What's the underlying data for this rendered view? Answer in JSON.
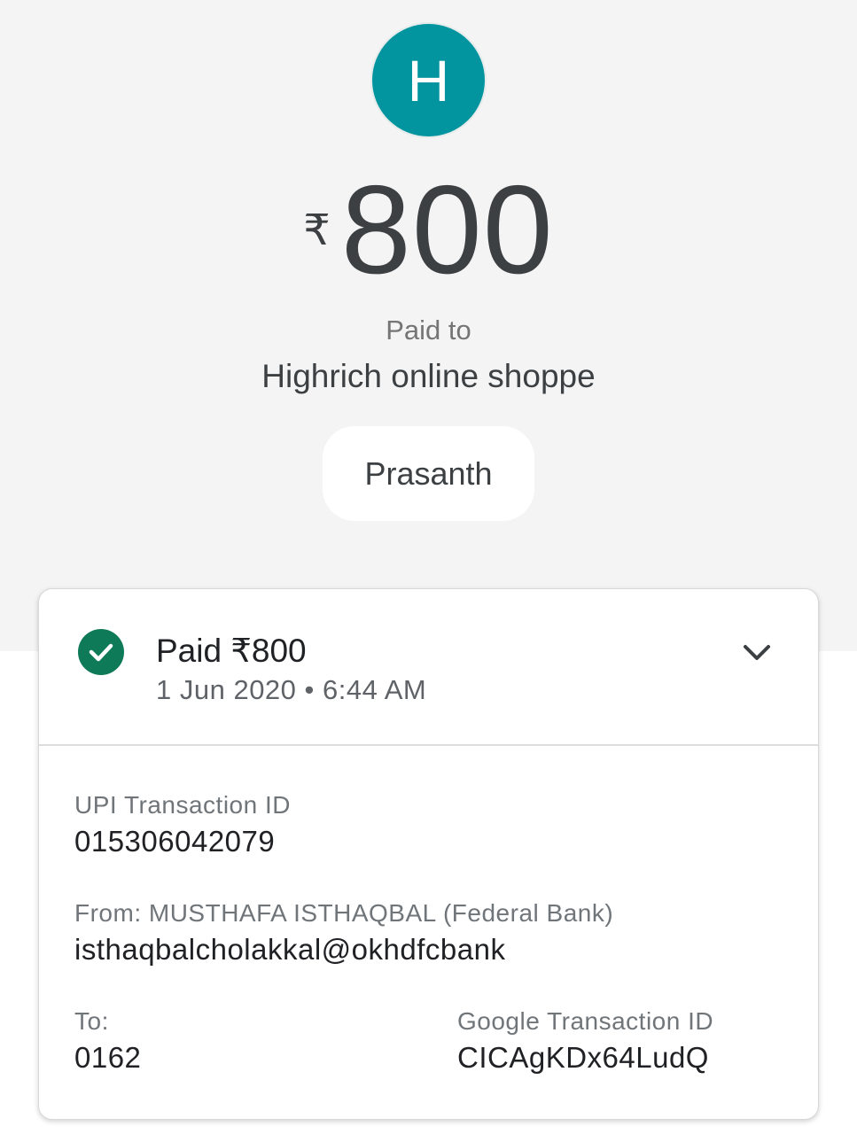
{
  "header": {
    "avatar_letter": "H",
    "avatar_color": "#03959f",
    "currency_symbol": "₹",
    "amount": "800",
    "paid_to_label": "Paid to",
    "merchant_name": "Highrich online shoppe",
    "payer_chip": "Prasanth"
  },
  "status": {
    "icon": "check-circle-icon",
    "icon_color": "#0f7a58",
    "title": "Paid ₹800",
    "datetime": "1 Jun 2020 • 6:44 AM",
    "expand_icon": "chevron-down-icon"
  },
  "details": {
    "upi_label": "UPI Transaction ID",
    "upi_value": "015306042079",
    "from_label": "From: MUSTHAFA ISTHAQBAL (Federal Bank)",
    "from_value": "isthaqbalcholakkal@okhdfcbank",
    "to_label": "To:",
    "to_value": "0162",
    "google_label": "Google Transaction ID",
    "google_value": "CICAgKDx64LudQ"
  }
}
